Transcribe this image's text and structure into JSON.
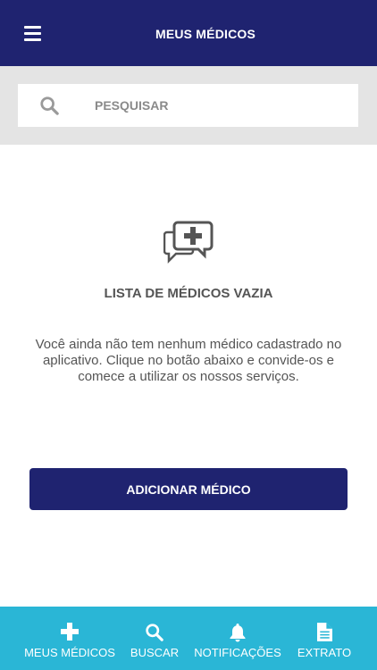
{
  "header": {
    "title": "MEUS MÉDICOS",
    "menu_icon": "hamburger-menu-icon",
    "background": "#1f2370"
  },
  "search": {
    "placeholder": "PESQUISAR",
    "icon": "search-icon"
  },
  "empty_state": {
    "icon": "chat-plus-icon",
    "title": "LISTA DE MÉDICOS VAZIA",
    "description": "Você ainda não tem nenhum médico cadastrado no aplicativo. Clique no botão abaixo e convide-os e comece a utilizar os nossos serviços."
  },
  "add_button": {
    "label": "ADICIONAR MÉDICO"
  },
  "bottom_nav": {
    "background": "#2ab6d6",
    "items": [
      {
        "label": "MEUS MÉDICOS",
        "icon": "plus-icon"
      },
      {
        "label": "BUSCAR",
        "icon": "search-icon"
      },
      {
        "label": "NOTIFICAÇÕES",
        "icon": "bell-icon"
      },
      {
        "label": "EXTRATO",
        "icon": "document-icon"
      }
    ]
  }
}
